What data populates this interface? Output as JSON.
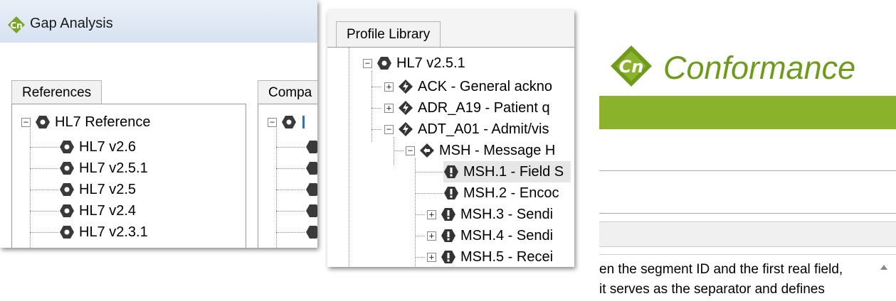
{
  "gap_window": {
    "title": "Gap Analysis",
    "left_tab": "References",
    "right_tab": "Compa",
    "tree": {
      "root": "HL7 Reference",
      "children": [
        "HL7 v2.6",
        "HL7 v2.5.1",
        "HL7 v2.5",
        "HL7 v2.4",
        "HL7 v2.3.1"
      ]
    }
  },
  "profile_window": {
    "tab": "Profile Library",
    "tree": [
      {
        "label": "HL7 v2.5.1"
      },
      {
        "label": "ACK - General ackno"
      },
      {
        "label": "ADR_A19 - Patient q"
      },
      {
        "label": "ADT_A01 - Admit/vis"
      },
      {
        "label": "MSH - Message H"
      },
      {
        "label": "MSH.1 - Field S"
      },
      {
        "label": "MSH.2 - Encoc"
      },
      {
        "label": "MSH.3 - Sendi"
      },
      {
        "label": "MSH.4 - Sendi"
      },
      {
        "label": "MSH.5 - Recei"
      }
    ]
  },
  "conformance_window": {
    "brand": "Conformance",
    "brand_color": "#6e9b1c",
    "bar_color": "#8ab22a",
    "description_lines": [
      "en the segment ID and the first real field,",
      "it serves as the separator and defines"
    ]
  },
  "colors": {
    "title_bar": "#dfe8f4",
    "selection": "#e6e6e6"
  }
}
